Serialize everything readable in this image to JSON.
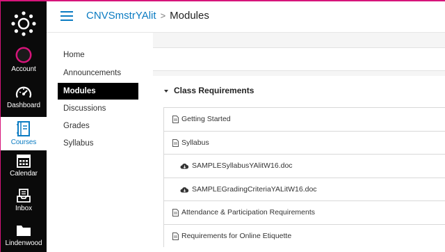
{
  "global_nav": {
    "items": [
      {
        "label": "Account",
        "icon": "account-avatar-icon"
      },
      {
        "label": "Dashboard",
        "icon": "dashboard-icon"
      },
      {
        "label": "Courses",
        "icon": "courses-icon"
      },
      {
        "label": "Calendar",
        "icon": "calendar-icon"
      },
      {
        "label": "Inbox",
        "icon": "inbox-icon"
      },
      {
        "label": "Lindenwood",
        "icon": "folder-icon"
      }
    ]
  },
  "header": {
    "course": "CNVSmstrYAlit",
    "separator": ">",
    "current": "Modules"
  },
  "course_nav": {
    "items": [
      "Home",
      "Announcements",
      "Modules",
      "Discussions",
      "Grades",
      "Syllabus"
    ]
  },
  "module": {
    "title": "Class Requirements",
    "items": [
      {
        "title": "Getting Started",
        "type": "page"
      },
      {
        "title": "Syllabus",
        "type": "page"
      },
      {
        "title": "SAMPLESyllabusYAlitW16.doc",
        "type": "file"
      },
      {
        "title": "SAMPLEGradingCriteriaYALitW16.doc",
        "type": "file"
      },
      {
        "title": "Attendance & Participation Requirements",
        "type": "page"
      },
      {
        "title": "Requirements for Online Etiquette",
        "type": "page"
      }
    ]
  },
  "colors": {
    "brand_accent": "#d6147a",
    "link": "#0a7bc2",
    "nav_bg": "#0a0a0a"
  }
}
